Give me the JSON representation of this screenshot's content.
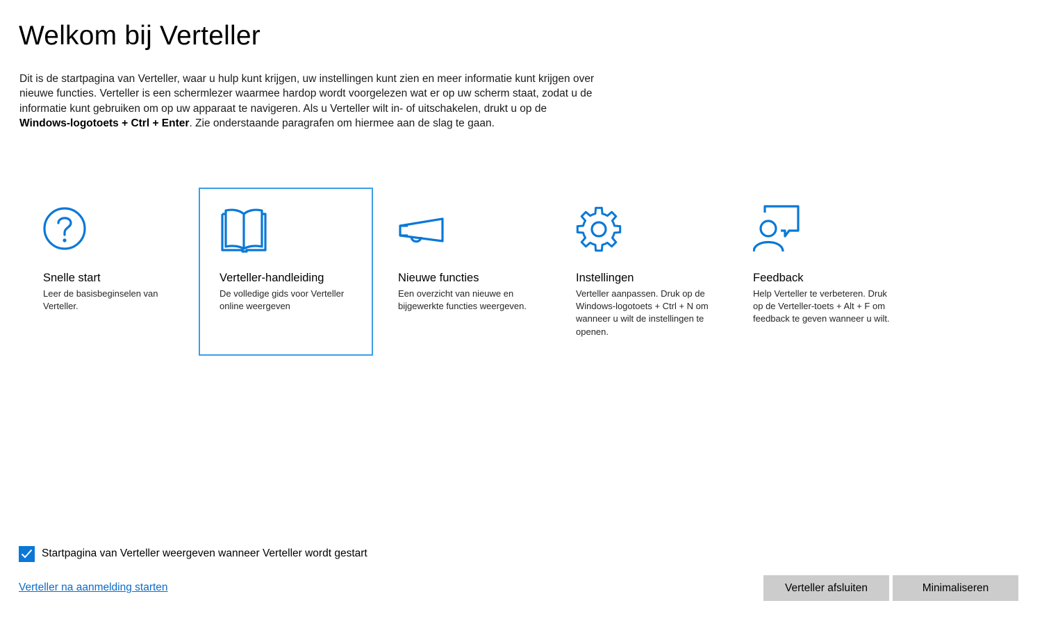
{
  "header": {
    "title": "Welkom bij Verteller"
  },
  "intro": {
    "text_before": "Dit is de startpagina van Verteller, waar u hulp kunt krijgen, uw instellingen kunt zien en meer informatie kunt krijgen over nieuwe functies. Verteller is een schermlezer waarmee hardop wordt voorgelezen wat er op uw scherm staat, zodat u de informatie kunt gebruiken om op uw apparaat te navigeren. Als u Verteller wilt in- of uitschakelen, drukt u op de ",
    "bold": "Windows-logotoets + Ctrl + Enter",
    "text_after": ". Zie onderstaande paragrafen om hiermee aan de slag te gaan."
  },
  "tiles": [
    {
      "icon": "question-circle-icon",
      "title": "Snelle start",
      "description": "Leer de basisbeginselen van Verteller.",
      "selected": false
    },
    {
      "icon": "book-icon",
      "title": "Verteller-handleiding",
      "description": "De volledige gids voor Verteller online weergeven",
      "selected": true
    },
    {
      "icon": "megaphone-icon",
      "title": "Nieuwe functies",
      "description": "Een overzicht van nieuwe en bijgewerkte functies weergeven.",
      "selected": false
    },
    {
      "icon": "gear-icon",
      "title": "Instellingen",
      "description": "Verteller aanpassen. Druk op de Windows-logotoets + Ctrl + N om wanneer u wilt de instellingen te openen.",
      "selected": false
    },
    {
      "icon": "feedback-person-icon",
      "title": "Feedback",
      "description": "Help Verteller te verbeteren. Druk op de Verteller-toets + Alt + F om feedback te geven wanneer u wilt.",
      "selected": false
    }
  ],
  "startup_checkbox": {
    "label": "Startpagina van Verteller weergeven wanneer Verteller wordt gestart",
    "checked": true
  },
  "link": {
    "label": "Verteller na aanmelding starten"
  },
  "buttons": {
    "exit_label": "Verteller afsluiten",
    "minimize_label": "Minimaliseren"
  },
  "colors": {
    "accent": "#0a78d7",
    "selection_border": "#3a9ee6",
    "button_bg": "#cccccc",
    "link": "#0a6cc9"
  }
}
